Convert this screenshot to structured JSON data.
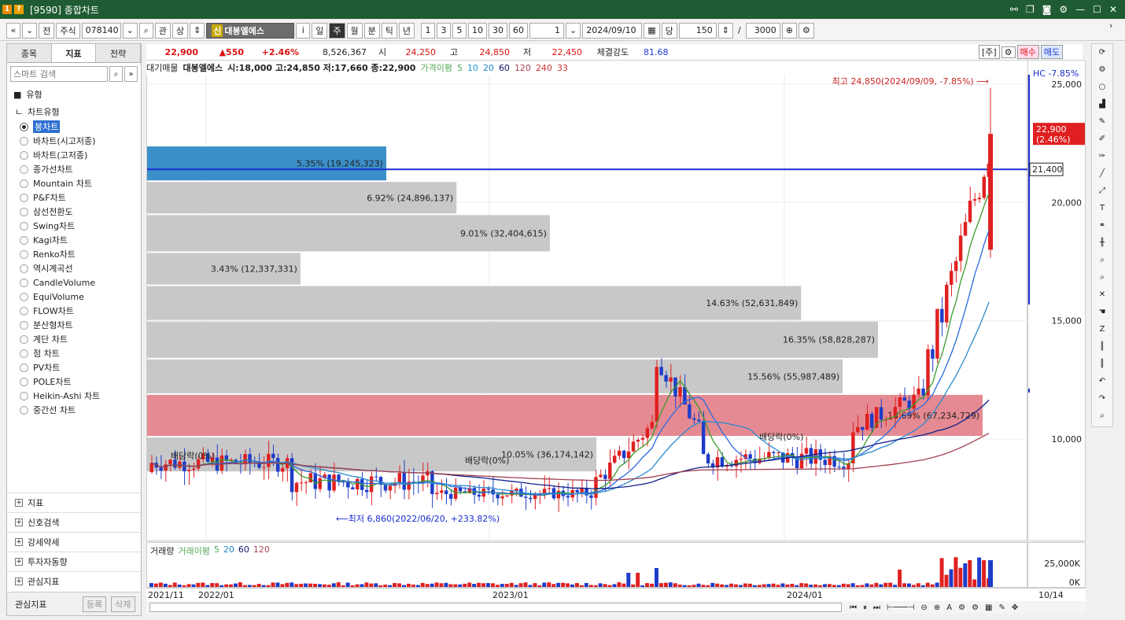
{
  "window": {
    "num1": "1",
    "num2": "?",
    "title": "[9590] 종합차트"
  },
  "toolbar": {
    "nav_back": "«",
    "nav_dn": "⌄",
    "jeon": "전",
    "market": "주식",
    "code": "078140",
    "gwan": "관",
    "sang": "상",
    "stock_tag": "신",
    "stock_name": "대봉엘에스",
    "info": "i",
    "periods": [
      "일",
      "주",
      "월",
      "분",
      "틱",
      "년"
    ],
    "period_selected": "주",
    "intervals": [
      "1",
      "3",
      "5",
      "10",
      "30",
      "60"
    ],
    "num_value": "1",
    "date": "2024/09/10",
    "dang": "당",
    "count": "150",
    "slash": "/",
    "total": "3000"
  },
  "left": {
    "tabs": [
      "종목",
      "지표",
      "전략"
    ],
    "tab_selected": "지표",
    "search_placeholder": "스마트 검색",
    "type_section": "유형",
    "type_group": "차트유형",
    "chart_types": [
      "봉차트",
      "바차트(시고저종)",
      "바차트(고저종)",
      "종가선차트",
      "Mountain 차트",
      "P&F차트",
      "삼선전환도",
      "Swing차트",
      "Kagi차트",
      "Renko차트",
      "역시계곡선",
      "CandleVolume",
      "EquiVolume",
      "FLOW차트",
      "분산형차트",
      "계단 차트",
      "점 차트",
      "PV차트",
      "POLE차트",
      "Heikin-Ashi 차트",
      "중간선 차트"
    ],
    "chart_type_selected": "봉차트",
    "sections": [
      "지표",
      "신호검색",
      "강세약세",
      "투자자동향",
      "관심지표"
    ],
    "fav_label": "관심지표",
    "register": "등록",
    "delete": "삭제"
  },
  "quote": {
    "price": "22,900",
    "change": "▲550",
    "pct": "+2.46%",
    "volume": "8,526,367",
    "open_label": "시",
    "open": "24,250",
    "high_label": "고",
    "high": "24,850",
    "low_label": "저",
    "low": "22,450",
    "strength_label": "체결강도",
    "strength": "81.68",
    "ju": "[주]",
    "buy": "매수",
    "sell": "매도"
  },
  "legend": {
    "prefix": "대기매물",
    "name": "대봉엘에스",
    "ohlc": "시:18,000 고:24,850 저:17,660 종:22,900",
    "ma_label": "가격이평",
    "ma": [
      "5",
      "10",
      "20",
      "60",
      "120",
      "240",
      "33"
    ]
  },
  "chart_data": {
    "type": "candlestick",
    "annotations": {
      "high": "최고 24,850(2024/09/09, -7.85%)",
      "low": "최저 6,860(2022/06/20, +233.82%)",
      "div1": "배당락(0%)",
      "div2": "배당락(0%)",
      "div3": "배당락(0%)"
    },
    "price_ticks": [
      "25,000",
      "20,000",
      "15,000",
      "10,000"
    ],
    "hc_label": "HC -7.85%",
    "current": {
      "price": "22,900",
      "pct": "(2.46%)"
    },
    "hline": {
      "value": 21400,
      "label": "21,400"
    },
    "volume_profile": [
      {
        "label": "5.35% (19,245,323)",
        "low": 20900,
        "high": 22400,
        "pct": 5.35,
        "highlight": "blue"
      },
      {
        "label": "6.92% (24,896,137)",
        "low": 19500,
        "high": 20900,
        "pct": 6.92
      },
      {
        "label": "9.01% (32,404,615)",
        "low": 17900,
        "high": 19500,
        "pct": 9.01
      },
      {
        "label": "3.43% (12,337,331)",
        "low": 16500,
        "high": 17900,
        "pct": 3.43
      },
      {
        "label": "14.63% (52,631,849)",
        "low": 15000,
        "high": 16500,
        "pct": 14.63
      },
      {
        "label": "16.35% (58,828,287)",
        "low": 13400,
        "high": 15000,
        "pct": 16.35
      },
      {
        "label": "15.56% (55,987,489)",
        "low": 11900,
        "high": 13400,
        "pct": 15.56
      },
      {
        "label": "18.69% (67,234,729)",
        "low": 10100,
        "high": 11900,
        "pct": 18.69,
        "highlight": "red"
      },
      {
        "label": "10.05% (36,174,142)",
        "low": 8600,
        "high": 10100,
        "pct": 10.05
      }
    ],
    "volume_legend": {
      "prefix": "거래량",
      "ma_label": "거래이평",
      "ma": [
        "5",
        "20",
        "60",
        "120"
      ]
    },
    "volume_ticks": [
      "25,000K",
      "0K"
    ],
    "dates": [
      "2021/11",
      "2022/01",
      "2023/01",
      "2024/01"
    ],
    "last_date": "10/14"
  }
}
